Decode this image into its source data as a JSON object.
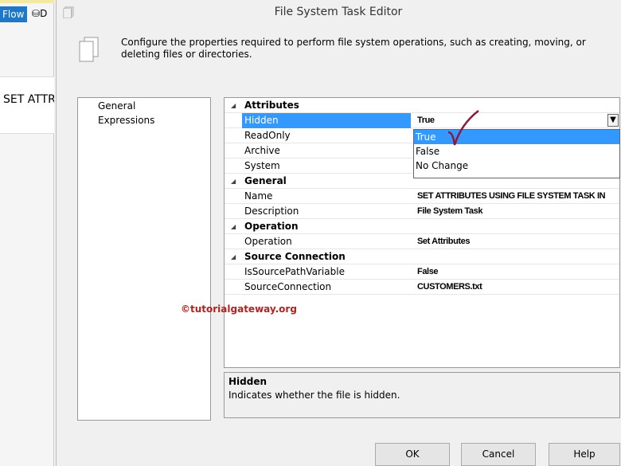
{
  "background": {
    "flow_tab": "Flow",
    "partial_label": "D",
    "task_text": "SET ATTRIBUTES USING FILE SYSTEM TASK"
  },
  "dialog": {
    "title": "File System Task Editor",
    "description": "Configure the properties required to perform file system operations, such as creating, moving, or deleting files or directories."
  },
  "nav": [
    "General",
    "Expressions"
  ],
  "grid": [
    {
      "cat": "Attributes"
    },
    {
      "k": "Hidden",
      "v": "True",
      "sel": true
    },
    {
      "k": "ReadOnly",
      "v": ""
    },
    {
      "k": "Archive",
      "v": ""
    },
    {
      "k": "System",
      "v": ""
    },
    {
      "cat": "General"
    },
    {
      "k": "Name",
      "v": "SET ATTRIBUTES USING FILE SYSTEM TASK IN"
    },
    {
      "k": "Description",
      "v": "File System Task"
    },
    {
      "cat": "Operation"
    },
    {
      "k": "Operation",
      "v": "Set Attributes"
    },
    {
      "cat": "Source Connection"
    },
    {
      "k": "IsSourcePathVariable",
      "v": "False"
    },
    {
      "k": "SourceConnection",
      "v": "CUSTOMERS.txt"
    }
  ],
  "dropdown": {
    "options": [
      "True",
      "False",
      "No Change"
    ],
    "highlighted": "True"
  },
  "help": {
    "title": "Hidden",
    "text": "Indicates whether the file is hidden."
  },
  "watermark": "©tutorialgateway.org",
  "buttons": {
    "ok": "OK",
    "cancel": "Cancel",
    "help": "Help"
  }
}
